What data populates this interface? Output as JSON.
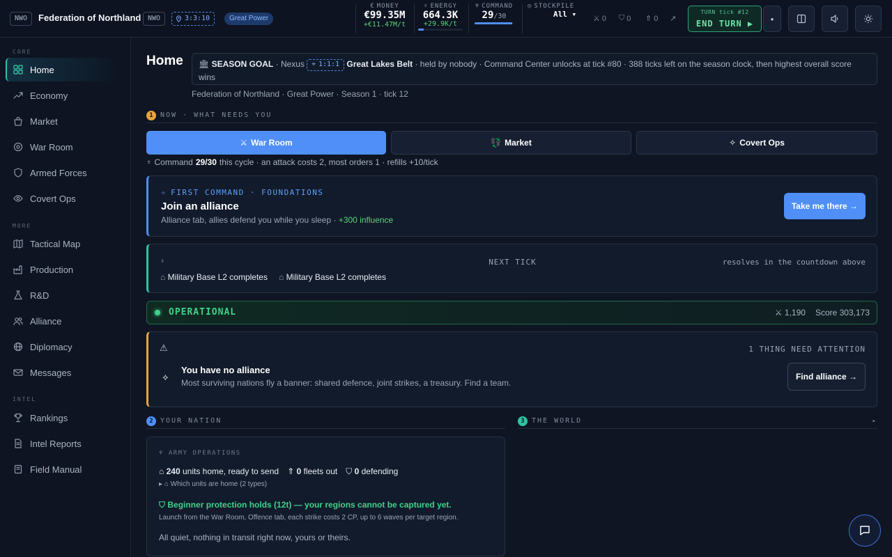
{
  "topbar": {
    "nation_tag": "NWO",
    "nation_name": "Federation of Northland",
    "nation_tag2": "NWO",
    "coord": "3:3:10",
    "power_badge": "Great Power",
    "money": {
      "label": "MONEY",
      "value": "€99.35M",
      "rate": "+€11.47M/t"
    },
    "energy": {
      "label": "ENERGY",
      "value": "664.3K",
      "rate": "+29.9K/t",
      "fill": 0.12
    },
    "command": {
      "label": "COMMAND",
      "value": "29",
      "max": "/30",
      "fill": 0.97
    },
    "stockpile": {
      "label": "STOCKPILE",
      "value": "All ▾"
    },
    "stat_attack": "0",
    "stat_defense": "0",
    "stat_fleet": "0",
    "turn_label": "TURN tick #12",
    "end_turn": "END TURN ▶",
    "dot_label": "•"
  },
  "sidebar": {
    "core_label": "CORE",
    "more_label": "MORE",
    "intel_label": "INTEL",
    "core": [
      {
        "label": "Home",
        "icon": "grid-icon"
      },
      {
        "label": "Economy",
        "icon": "trend-icon"
      },
      {
        "label": "Market",
        "icon": "bag-icon"
      },
      {
        "label": "War Room",
        "icon": "target-icon"
      },
      {
        "label": "Armed Forces",
        "icon": "shield-icon"
      },
      {
        "label": "Covert Ops",
        "icon": "eye-icon"
      }
    ],
    "more": [
      {
        "label": "Tactical Map",
        "icon": "map-icon"
      },
      {
        "label": "Production",
        "icon": "factory-icon"
      },
      {
        "label": "R&D",
        "icon": "flask-icon"
      },
      {
        "label": "Alliance",
        "icon": "users-icon"
      },
      {
        "label": "Diplomacy",
        "icon": "globe-icon"
      },
      {
        "label": "Messages",
        "icon": "mail-icon"
      }
    ],
    "intel": [
      {
        "label": "Rankings",
        "icon": "trophy-icon"
      },
      {
        "label": "Intel Reports",
        "icon": "file-icon"
      },
      {
        "label": "Field Manual",
        "icon": "book-icon"
      }
    ]
  },
  "main": {
    "title": "Home",
    "season": {
      "prefix": "SEASON GOAL",
      "sep1": "· Nexus",
      "coord": "1:1:1",
      "region": "Great Lakes Belt",
      "rest1": "· held by nobody · Command Center unlocks at tick #80 · 388 ticks left on the season clock, then highest overall",
      "rest2": "score wins"
    },
    "subline": "Federation of Northland · Great Power · Season 1 · tick 12",
    "now_num": "1",
    "now_label": "NOW · WHAT NEEDS YOU",
    "quick": [
      {
        "label": "War Room",
        "icon": "swords-icon"
      },
      {
        "label": "Market",
        "icon": "exchange-icon"
      },
      {
        "label": "Covert Ops",
        "icon": "spark-icon"
      }
    ],
    "command_line": {
      "pre": "Command",
      "val": "29/30",
      "post": "this cycle · an attack costs 2, most orders 1 · refills +10/tick"
    },
    "first_command": {
      "kicker": "FIRST COMMAND · FOUNDATIONS",
      "title": "Join an alliance",
      "desc": "Alliance tab, allies defend you while you sleep ·",
      "reward": "+300 influence",
      "button": "Take me there →"
    },
    "next_tick": {
      "label": "NEXT TICK",
      "right": "resolves in the countdown above",
      "items": [
        "Military Base L2 completes",
        "Military Base L2 completes"
      ]
    },
    "operational": {
      "label": "OPERATIONAL",
      "power": "1,190",
      "score": "Score 303,173"
    },
    "attention": {
      "count": "1 THING NEED ATTENTION",
      "title": "You have no alliance",
      "desc": "Most surviving nations fly a banner: shared defence, joint strikes, a treasury. Find a team.",
      "button": "Find alliance →"
    },
    "your_nation": {
      "num": "2",
      "label": "YOUR NATION"
    },
    "the_world": {
      "num": "3",
      "label": "THE WORLD",
      "caret": "▸"
    },
    "army": {
      "title": "ARMY OPERATIONS",
      "home_n": "240",
      "home_t": "units home, ready to send",
      "fleets_n": "0",
      "fleets_t": "fleets out",
      "def_n": "0",
      "def_t": "defending",
      "toggle": "Which units are home (2 types)",
      "protection": "Beginner protection holds (12t) — your regions cannot be captured yet.",
      "launch": "Launch from the War Room, Offence tab, each strike costs 2 CP, up to 6 waves per target region.",
      "quiet": "All quiet, nothing in transit right now, yours or theirs."
    }
  },
  "colors": {
    "accent": "#4f8ff7",
    "teal": "#2fc4a3",
    "green": "#5bd27d",
    "amber": "#e8a43c"
  }
}
